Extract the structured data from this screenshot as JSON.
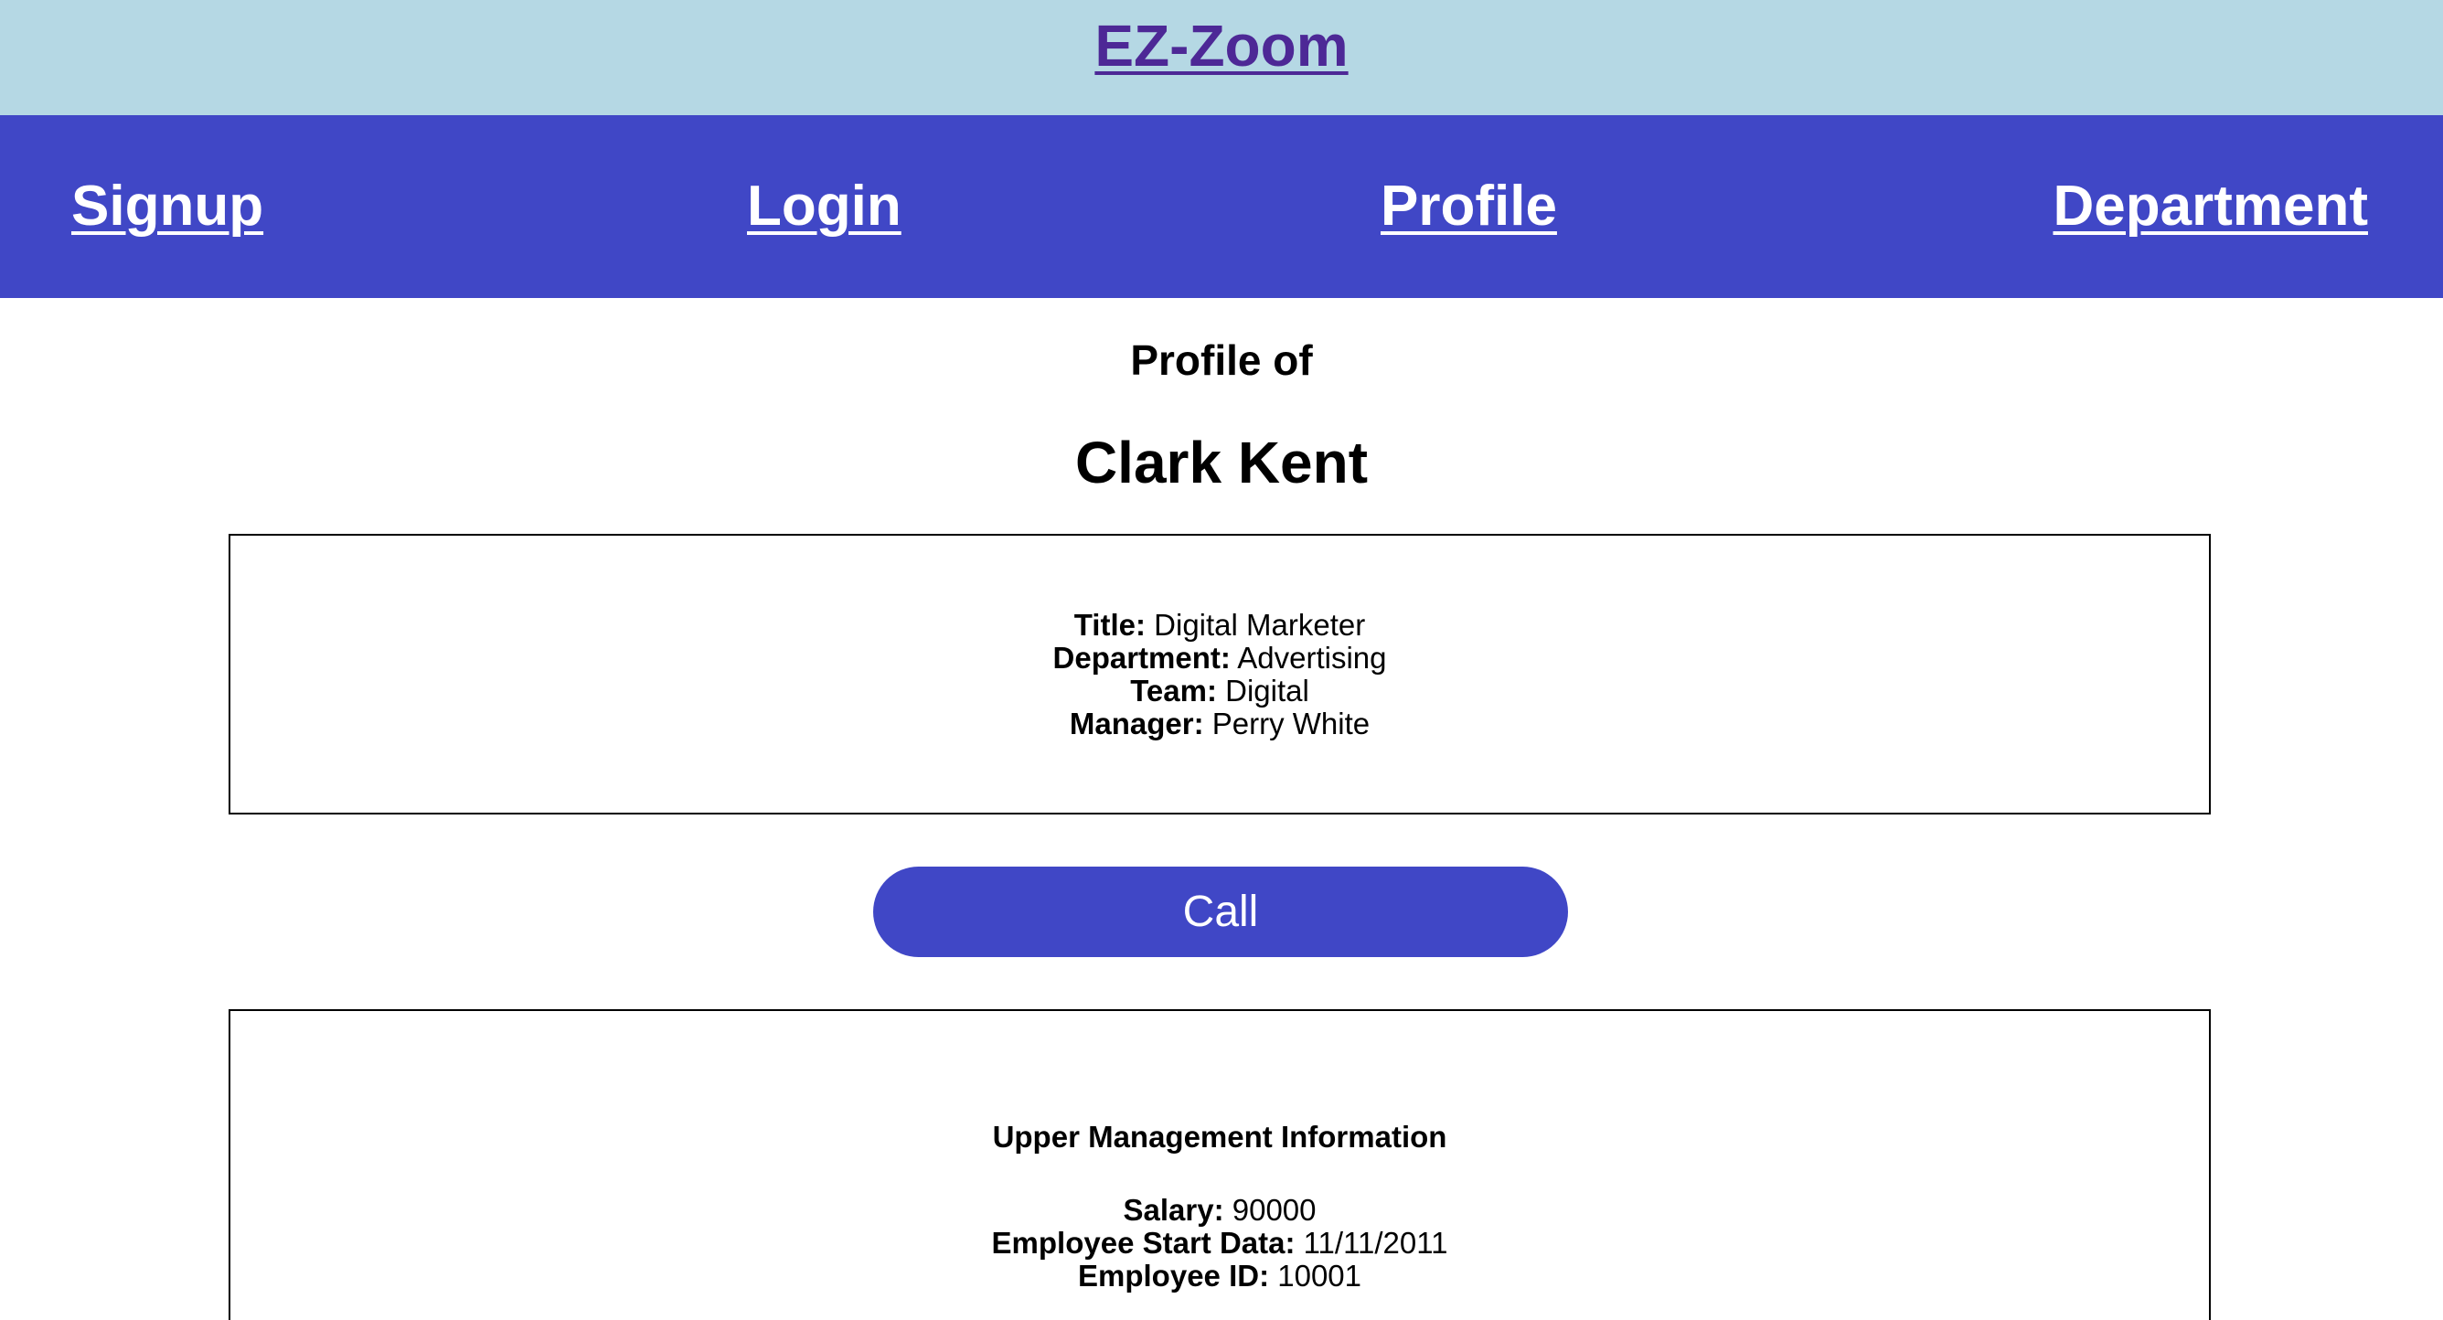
{
  "header": {
    "brand": "EZ-Zoom"
  },
  "nav": {
    "signup": "Signup",
    "login": "Login",
    "profile": "Profile",
    "department": "Department"
  },
  "profile": {
    "heading": "Profile of",
    "name": "Clark Kent",
    "details": {
      "title_label": "Title:",
      "title_value": "Digital Marketer",
      "department_label": "Department:",
      "department_value": "Advertising",
      "team_label": "Team:",
      "team_value": "Digital",
      "manager_label": "Manager:",
      "manager_value": "Perry White"
    },
    "call_label": "Call"
  },
  "management": {
    "heading": "Upper Management Information",
    "salary_label": "Salary:",
    "salary_value": "90000",
    "start_label": "Employee Start Data:",
    "start_value": "11/11/2011",
    "id_label": "Employee ID:",
    "id_value": "10001"
  },
  "colors": {
    "banner": "#b5d8e4",
    "nav": "#4047c6",
    "brand": "#4d2896",
    "button": "#4047c6"
  }
}
